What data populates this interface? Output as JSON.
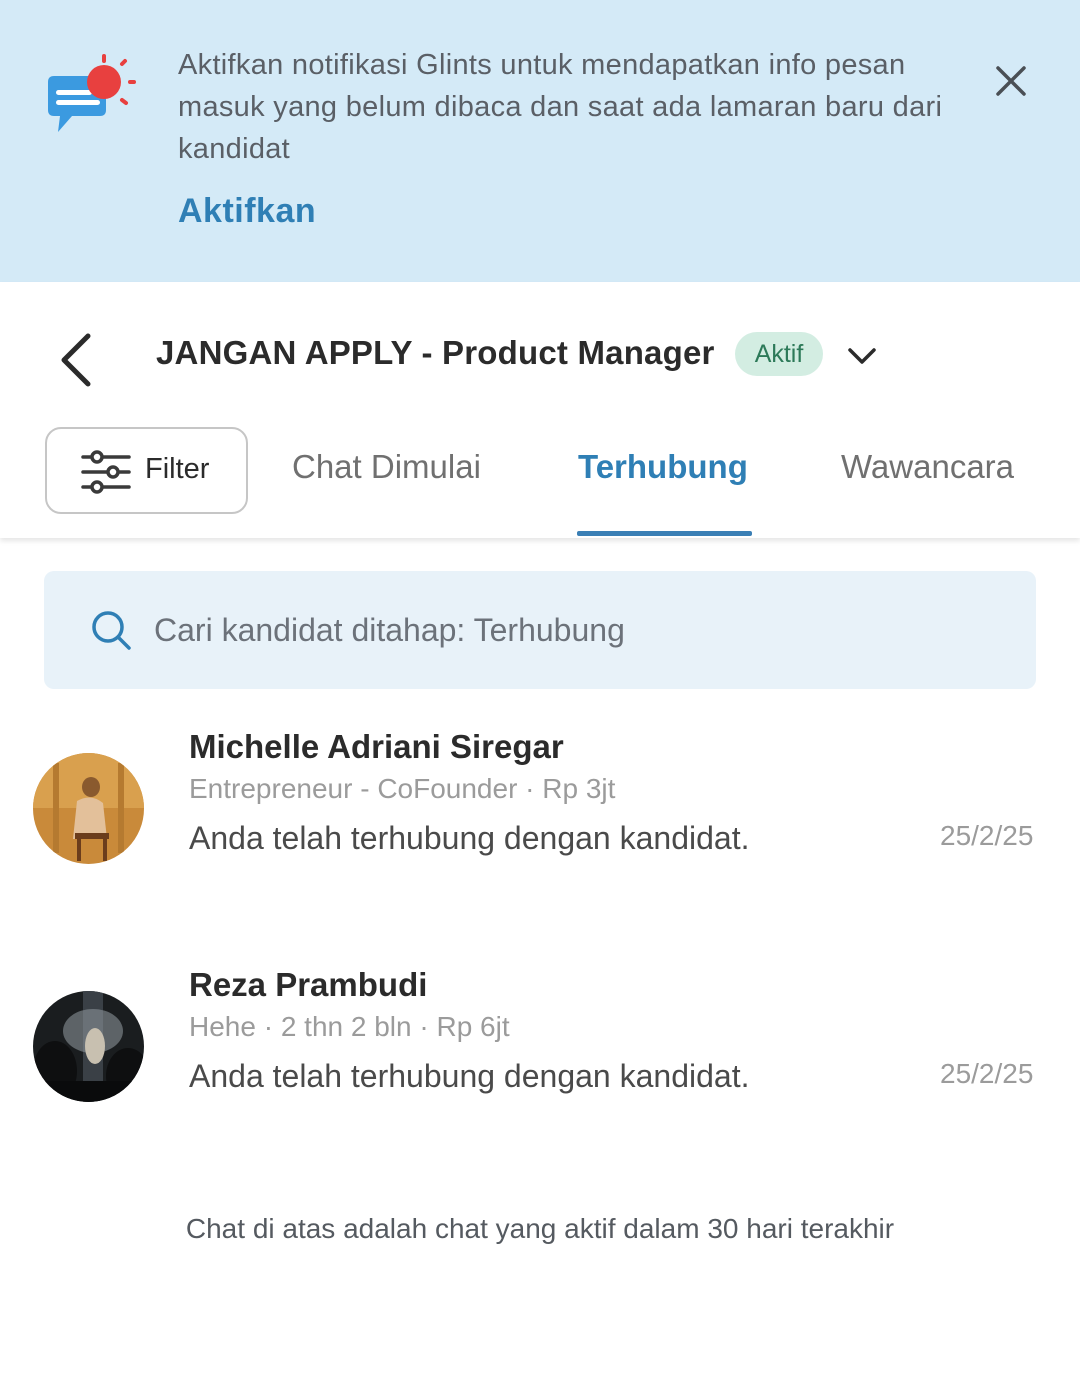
{
  "banner": {
    "message": "Aktifkan notifikasi Glints untuk mendapatkan info pesan masuk yang belum dibaca dan saat ada lamaran baru dari kandidat",
    "cta_label": "Aktifkan",
    "icon": "chat-notification-icon",
    "close_icon": "close-icon"
  },
  "header": {
    "job_title": "JANGAN APPLY - Product Manager",
    "status": "Aktif",
    "back_icon": "chevron-left-icon",
    "dropdown_icon": "chevron-down-icon"
  },
  "filter": {
    "label": "Filter",
    "icon": "sliders-icon"
  },
  "tabs": [
    {
      "label": "Chat Dimulai",
      "active": false
    },
    {
      "label": "Terhubung",
      "active": true
    },
    {
      "label": "Wawancara",
      "active": false
    }
  ],
  "search": {
    "placeholder": "Cari kandidat ditahap: Terhubung",
    "value": ""
  },
  "candidates": [
    {
      "name": "Michelle Adriani Siregar",
      "meta": "Entrepreneur - CoFounder · Rp 3jt",
      "message": "Anda telah terhubung dengan kandidat.",
      "date": "25/2/25"
    },
    {
      "name": "Reza Prambudi",
      "meta": "Hehe · 2 thn 2 bln · Rp 6jt",
      "message": "Anda telah terhubung dengan kandidat.",
      "date": "25/2/25"
    }
  ],
  "footer_note": "Chat di atas adalah chat yang aktif dalam 30 hari terakhir",
  "colors": {
    "banner_bg": "#d4eaf7",
    "accent": "#2f7fb5",
    "status_bg": "#d3ede2",
    "status_text": "#2d7a59",
    "search_bg": "#e8f2f9"
  }
}
